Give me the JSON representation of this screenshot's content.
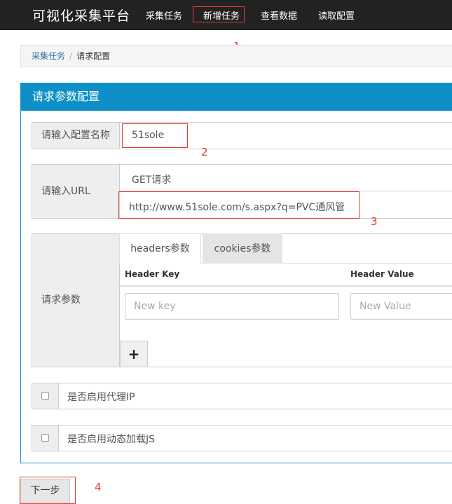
{
  "navbar": {
    "brand": "可视化采集平台",
    "items": [
      "采集任务",
      "新增任务",
      "查看数据",
      "读取配置"
    ]
  },
  "annotations": [
    "1",
    "2",
    "3",
    "4"
  ],
  "breadcrumb": {
    "link": "采集任务",
    "separator": "/",
    "current": "请求配置"
  },
  "panel": {
    "title": "请求参数配置"
  },
  "config_name": {
    "label": "请输入配置名称",
    "value": "51sole"
  },
  "url": {
    "label": "请输入URL",
    "method": "GET请求",
    "value": "http://www.51sole.com/s.aspx?q=PVC通风管"
  },
  "params": {
    "label": "请求参数",
    "tabs": [
      "headers参数",
      "cookies参数"
    ],
    "columns": [
      "Header Key",
      "Header Value"
    ],
    "key_placeholder": "New key",
    "value_placeholder": "New Value",
    "add_symbol": "+"
  },
  "options": {
    "proxy_label": "是否启用代理IP",
    "js_label": "是否启用动态加载JS"
  },
  "next_button": "下一步"
}
